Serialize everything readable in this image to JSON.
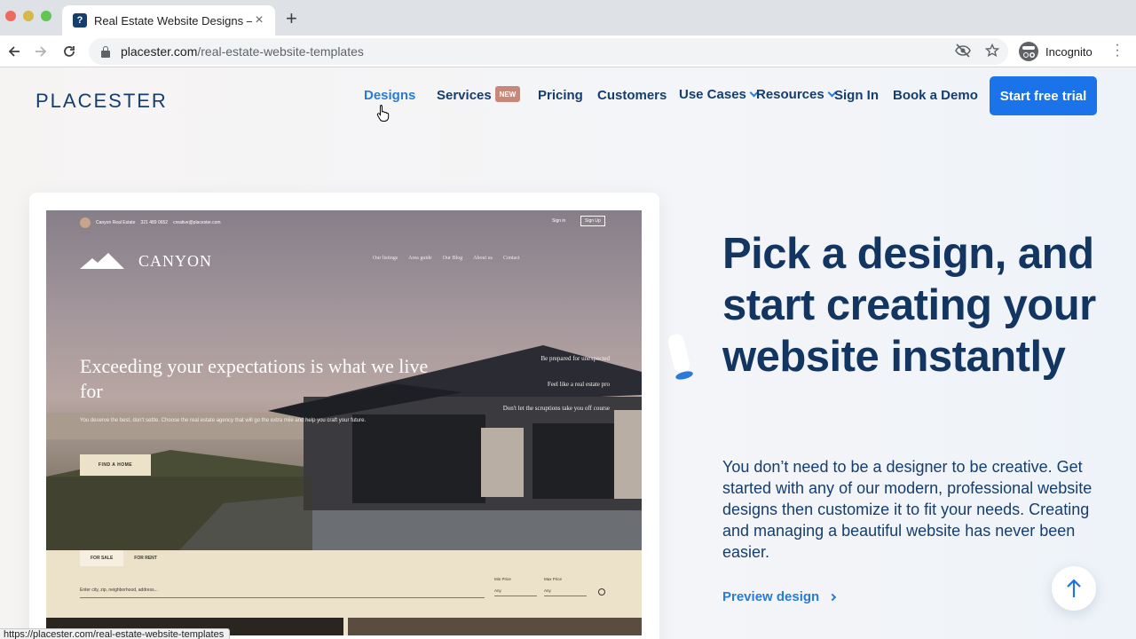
{
  "browser": {
    "tab_title": "Real Estate Website Designs –",
    "favicon_text": "?",
    "url_host": "placester.com",
    "url_path": "/real-estate-website-templates",
    "profile_label": "Incognito",
    "status_url": "https://placester.com/real-estate-website-templates"
  },
  "site": {
    "logo": "PLACESTER",
    "nav": {
      "designs": "Designs",
      "services": "Services",
      "new_badge": "NEW",
      "pricing": "Pricing",
      "customers": "Customers",
      "use_cases": "Use Cases",
      "resources": "Resources",
      "sign_in": "Sign In",
      "book_demo": "Book a Demo",
      "cta": "Start free trial"
    }
  },
  "preview": {
    "brand_line": "Canyon Real Estate",
    "phone": "321 489 0652",
    "email": "creative@placester.com",
    "sign_in": "Sign in",
    "sign_up": "Sign Up",
    "logo": "CANYON",
    "menu": [
      "Our listings",
      "Area guide",
      "Our Blog",
      "About us",
      "Contact"
    ],
    "headline": "Exceeding your expectations is what we live for",
    "subtext": "You deserve the best, don't settle. Choose the real estate agency that will go the extra mile and help you craft your future.",
    "button": "FIND A HOME",
    "features": [
      "Be prepared for unexpected",
      "Feel like a real estate pro",
      "Don't let the scruptions take you off course"
    ],
    "tab_sale": "FOR SALE",
    "tab_rent": "FOR RENT",
    "search_placeholder": "Enter city, zip, neighborhood, address...",
    "min_price_label": "Min Price",
    "min_price_value": "Any",
    "max_price_label": "Max Price",
    "max_price_value": "Any"
  },
  "hero": {
    "title": "Pick a design, and start creating your website instantly",
    "subtitle": "You don’t need to be a designer to be creative. Get started with any of our modern, professional website designs then customize it to fit your needs. Creating and managing a beautiful website has never been easier.",
    "link": "Preview design"
  },
  "colors": {
    "brand_navy": "#153e6e",
    "accent_blue": "#1a73e8",
    "link_blue": "#2a7bd5",
    "badge": "#c9877a"
  }
}
